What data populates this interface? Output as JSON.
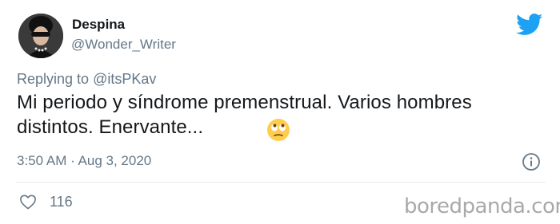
{
  "author": {
    "display_name": "Despina",
    "handle": "@Wonder_Writer"
  },
  "reply": {
    "prefix": "Replying to",
    "mention": "@itsPKav"
  },
  "tweet": {
    "text": "Mi periodo y síndrome premenstrual. Varios hombres distintos. Enervante...",
    "emoji": "face-with-rolling-eyes"
  },
  "meta": {
    "timestamp": "3:50 AM · Aug 3, 2020"
  },
  "engagement": {
    "likes": "116"
  },
  "watermark": "boredpanda.com",
  "colors": {
    "twitter_blue": "#1da1f2",
    "secondary_text": "#657786",
    "primary_text": "#14171a"
  }
}
